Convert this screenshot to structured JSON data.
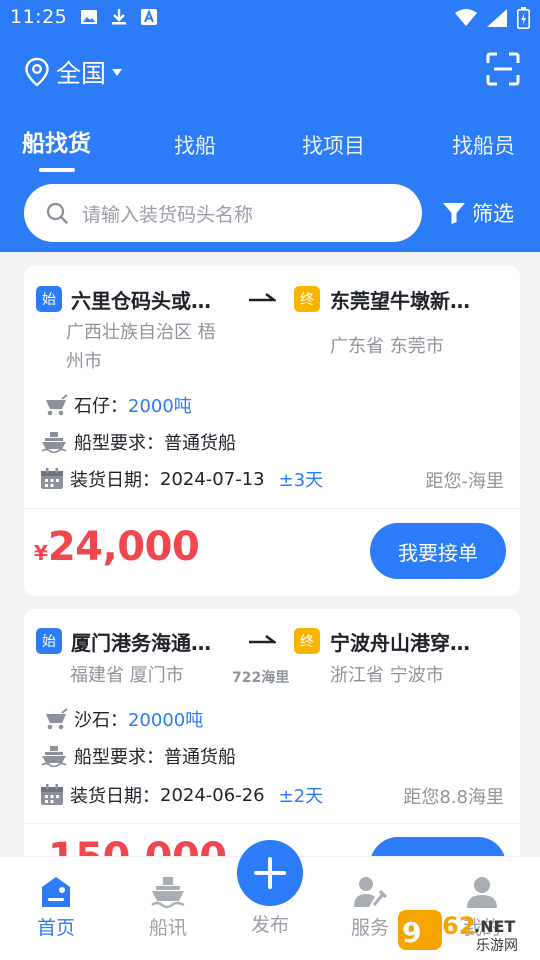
{
  "status_bar": {
    "time": "11:25"
  },
  "header": {
    "location": "全国",
    "tabs": [
      {
        "label": "船找货",
        "active": true
      },
      {
        "label": "找船",
        "active": false
      },
      {
        "label": "找项目",
        "active": false
      },
      {
        "label": "找船员",
        "active": false
      }
    ],
    "search_placeholder": "请输入装货码头名称",
    "filter_label": "筛选"
  },
  "cargo_list": [
    {
      "start_tag": "始",
      "start_name": "六里仓码头或…",
      "start_region_line1": "广西壮族自治区 梧",
      "start_region_line2": "州市",
      "end_tag": "终",
      "end_name": "东莞望牛墩新…",
      "end_region": "广东省 东莞市",
      "route_distance": "",
      "cargo_label": "石仔：",
      "cargo_amount": "2000吨",
      "ship_label": "船型要求：",
      "ship_type": "普通货船",
      "date_label": "装货日期：",
      "date": "2024-07-13",
      "date_range": "±3天",
      "distance_to_user": "距您-海里",
      "currency": "¥",
      "price": "24,000",
      "action_label": "我要接单"
    },
    {
      "start_tag": "始",
      "start_name": "厦门港务海通…",
      "start_region_line1": "福建省 厦门市",
      "start_region_line2": "",
      "end_tag": "终",
      "end_name": "宁波舟山港穿…",
      "end_region": "浙江省 宁波市",
      "route_distance": "722海里",
      "cargo_label": "沙石：",
      "cargo_amount": "20000吨",
      "ship_label": "船型要求：",
      "ship_type": "普通货船",
      "date_label": "装货日期：",
      "date": "2024-06-26",
      "date_range": "±2天",
      "distance_to_user": "距您8.8海里",
      "currency": "¥",
      "price": "150,000",
      "action_label": ""
    }
  ],
  "bottom_nav": [
    {
      "label": "首页",
      "icon": "home-icon",
      "active": true
    },
    {
      "label": "船讯",
      "icon": "ship-news-icon",
      "active": false
    },
    {
      "label": "发布",
      "icon": "plus-icon",
      "active": false
    },
    {
      "label": "服务",
      "icon": "service-icon",
      "active": false
    },
    {
      "label": "我的",
      "icon": "profile-icon",
      "active": false
    }
  ],
  "watermark": "962.NET 乐游网",
  "colors": {
    "primary": "#2b7cf6",
    "price": "#f0474f",
    "end_tag": "#f7b500"
  }
}
